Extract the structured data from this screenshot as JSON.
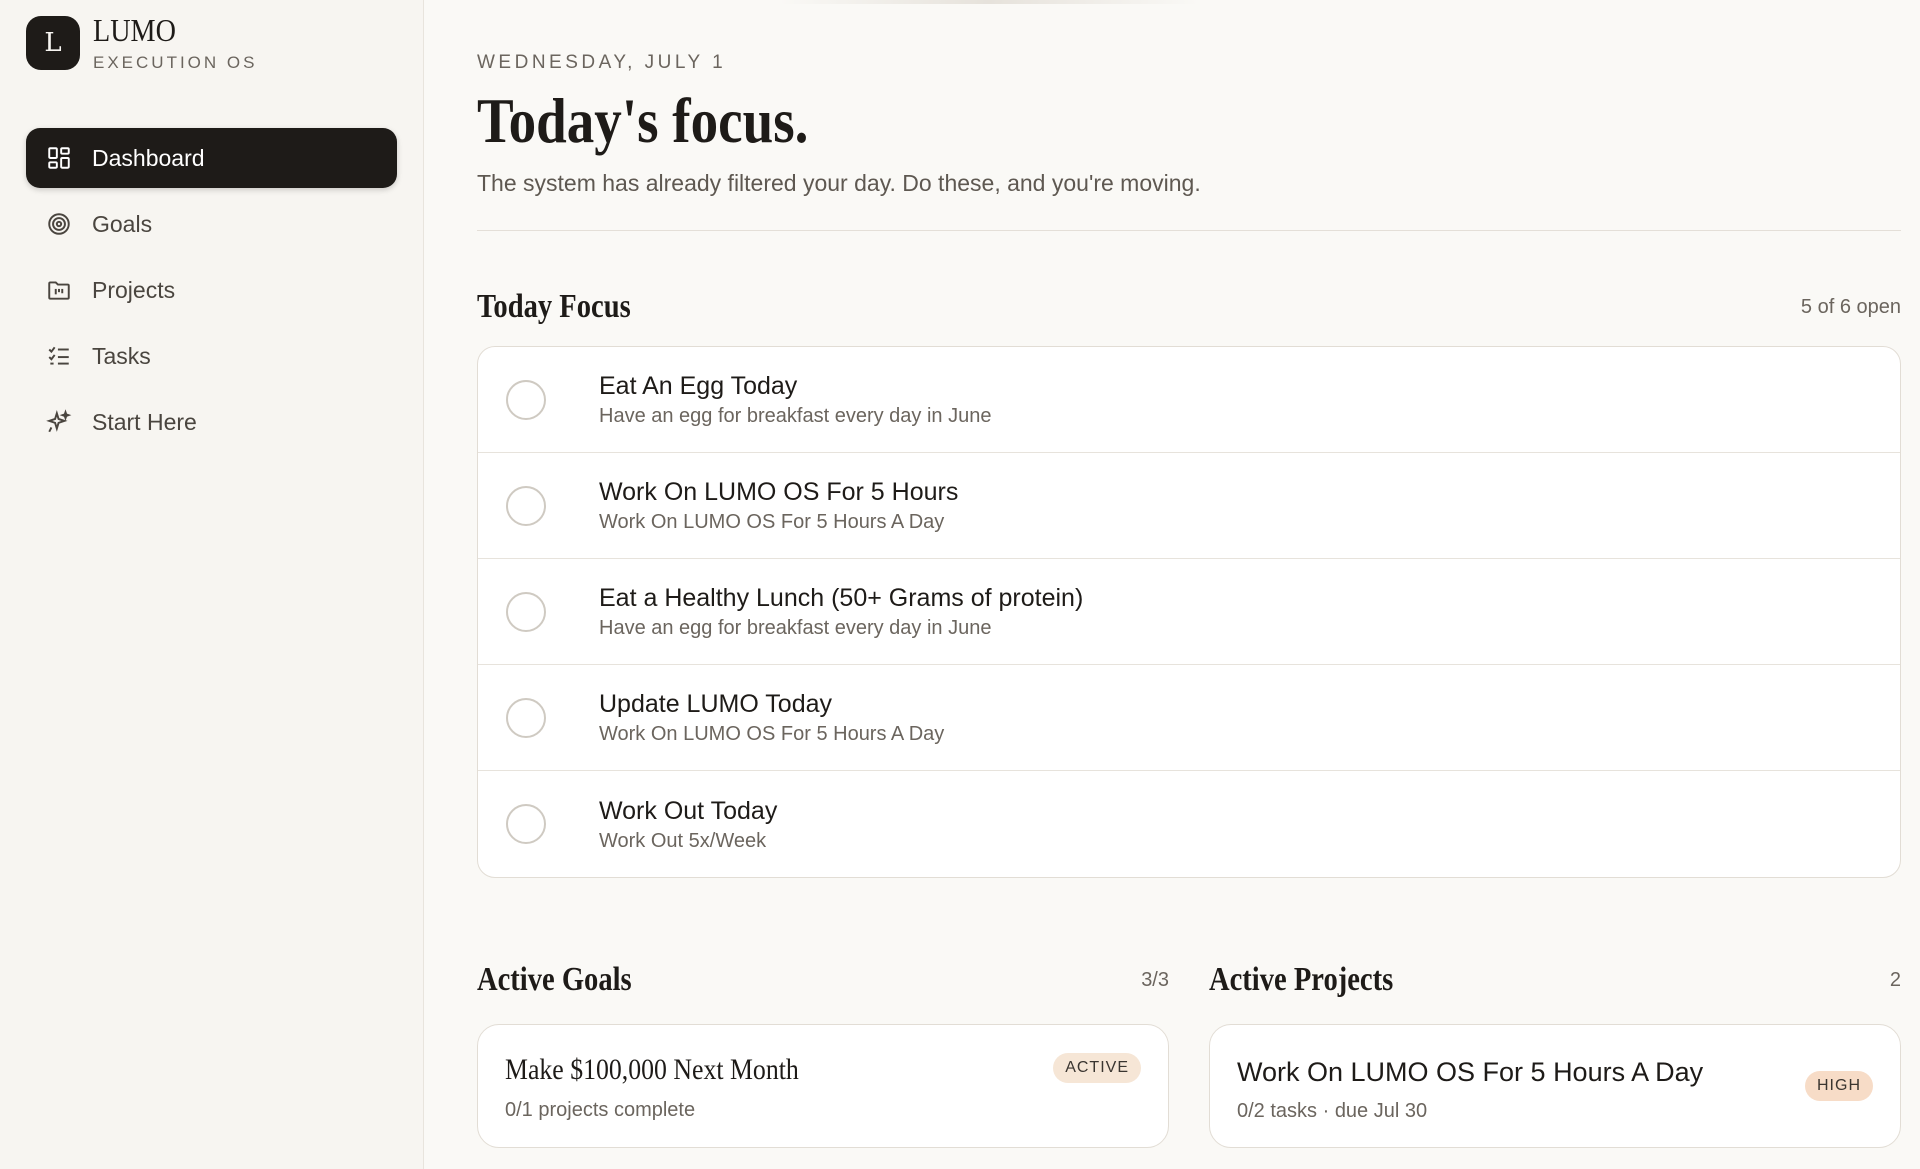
{
  "brand": {
    "logo_letter": "L",
    "name": "LUMO",
    "subtitle": "EXECUTION OS"
  },
  "sidebar": {
    "items": [
      {
        "label": "Dashboard",
        "icon": "dashboard-icon",
        "active": true
      },
      {
        "label": "Goals",
        "icon": "target-icon",
        "active": false
      },
      {
        "label": "Projects",
        "icon": "folder-icon",
        "active": false
      },
      {
        "label": "Tasks",
        "icon": "checklist-icon",
        "active": false
      },
      {
        "label": "Start Here",
        "icon": "sparkle-icon",
        "active": false
      }
    ]
  },
  "header": {
    "date": "WEDNESDAY, JULY 1",
    "title": "Today's focus.",
    "subtitle": "The system has already filtered your day. Do these, and you're moving."
  },
  "today_focus": {
    "title": "Today Focus",
    "count": "5 of 6 open",
    "tasks": [
      {
        "title": "Eat An Egg Today",
        "description": "Have an egg for breakfast every day in June"
      },
      {
        "title": "Work On LUMO OS For 5 Hours",
        "description": "Work On LUMO OS For 5 Hours A Day"
      },
      {
        "title": "Eat a Healthy Lunch (50+ Grams of protein)",
        "description": "Have an egg for breakfast every day in June"
      },
      {
        "title": "Update LUMO Today",
        "description": "Work On LUMO OS For 5 Hours A Day"
      },
      {
        "title": "Work Out Today",
        "description": "Work Out 5x/Week"
      }
    ]
  },
  "active_goals": {
    "title": "Active Goals",
    "count": "3/3",
    "cards": [
      {
        "title": "Make $100,000 Next Month",
        "meta": "0/1 projects complete",
        "badge": "ACTIVE"
      }
    ]
  },
  "active_projects": {
    "title": "Active Projects",
    "count": "2",
    "cards": [
      {
        "title": "Work On LUMO OS For 5 Hours A Day",
        "meta": "0/2 tasks · due Jul 30",
        "badge": "HIGH"
      }
    ]
  },
  "colors": {
    "background": "#faf9f6",
    "sidebar": "#f7f5f1",
    "ink": "#1e1b18",
    "muted": "#6b655e",
    "badge_active": "#f6e6d6",
    "badge_high": "#f7dcc7"
  }
}
